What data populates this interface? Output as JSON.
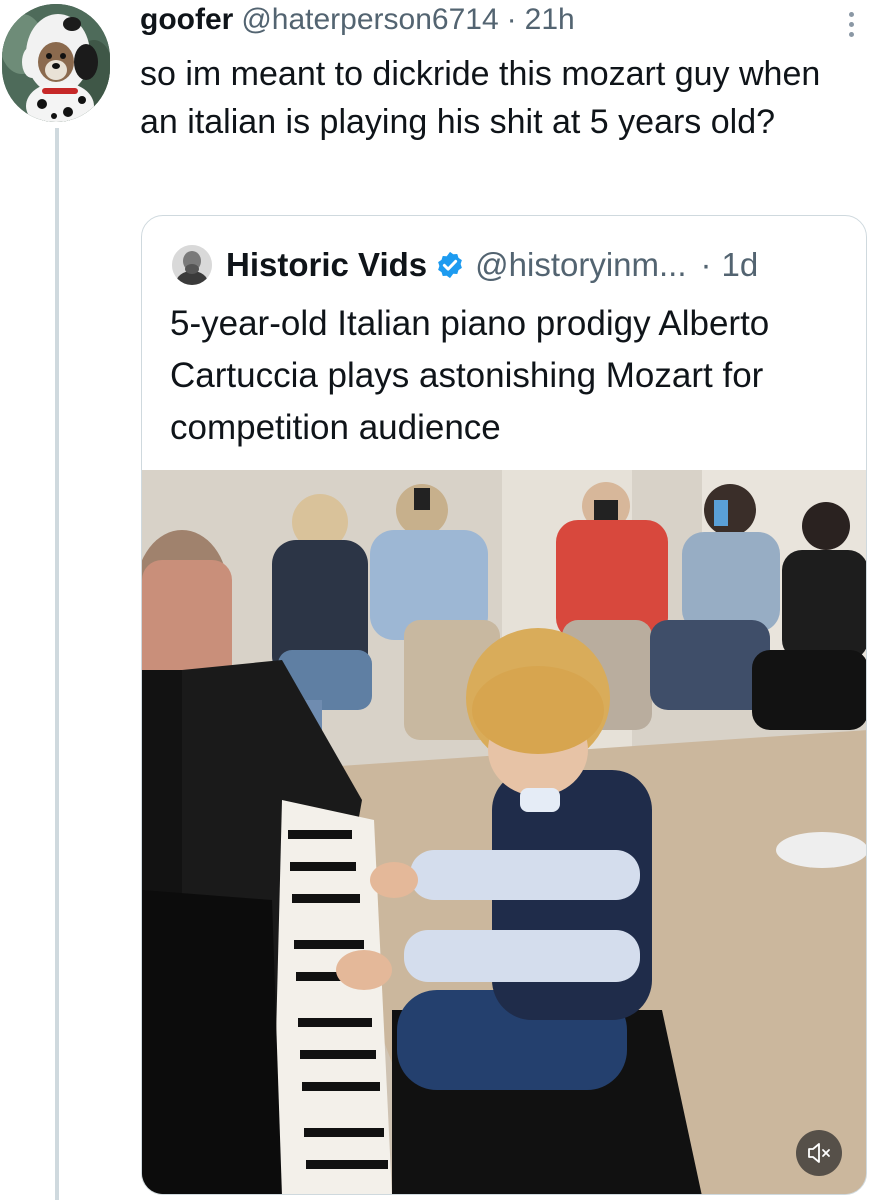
{
  "reply": {
    "display_name": "goofer",
    "handle": "@haterperson6714",
    "separator": "·",
    "time": "21h",
    "text": "so im meant to dickride this mozart guy when an italian is playing his shit at 5 years old?"
  },
  "quote": {
    "display_name": "Historic Vids",
    "handle": "@historyinm...",
    "separator": "·",
    "time": "1d",
    "text": "5-year-old Italian piano prodigy Alberto Cartuccia plays astonishing Mozart for competition audience",
    "verified_color": "#1d9bf0"
  },
  "media": {
    "mute_icon": "speaker-muted-icon"
  },
  "colors": {
    "secondary_text": "#536471",
    "border": "#cfd9de",
    "thread_line": "#cfd9de"
  }
}
